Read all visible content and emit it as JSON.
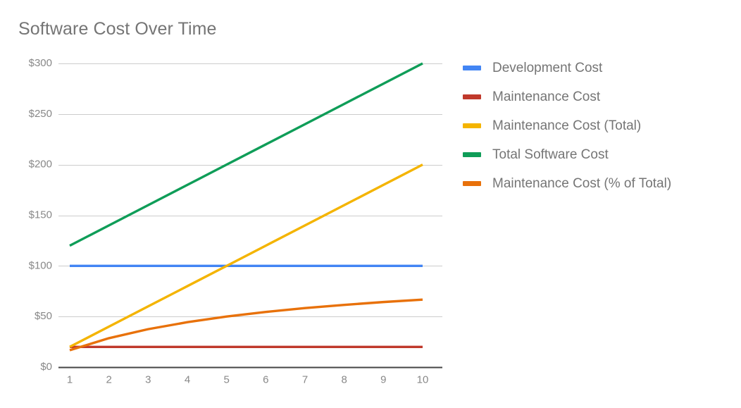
{
  "chart_data": {
    "type": "line",
    "title": "Software Cost Over Time",
    "xlabel": "",
    "ylabel": "",
    "x": [
      1,
      2,
      3,
      4,
      5,
      6,
      7,
      8,
      9,
      10
    ],
    "categories": [
      "1",
      "2",
      "3",
      "4",
      "5",
      "6",
      "7",
      "8",
      "9",
      "10"
    ],
    "xlim": [
      1,
      10
    ],
    "ylim": [
      0,
      300
    ],
    "y_ticks": [
      0,
      50,
      100,
      150,
      200,
      250,
      300
    ],
    "y_tick_labels": [
      "$0",
      "$50",
      "$100",
      "$150",
      "$200",
      "$250",
      "$300"
    ],
    "x_tick_labels": [
      "1",
      "2",
      "3",
      "4",
      "5",
      "6",
      "7",
      "8",
      "9",
      "10"
    ],
    "grid": true,
    "legend_position": "right",
    "series": [
      {
        "name": "Development Cost",
        "color": "#4285F4",
        "values": [
          100,
          100,
          100,
          100,
          100,
          100,
          100,
          100,
          100,
          100
        ]
      },
      {
        "name": "Maintenance Cost",
        "color": "#C0392B",
        "values": [
          20,
          20,
          20,
          20,
          20,
          20,
          20,
          20,
          20,
          20
        ]
      },
      {
        "name": "Maintenance Cost (Total)",
        "color": "#F4B400",
        "values": [
          20,
          40,
          60,
          80,
          100,
          120,
          140,
          160,
          180,
          200
        ]
      },
      {
        "name": "Total Software Cost",
        "color": "#0F9D58",
        "values": [
          120,
          140,
          160,
          180,
          200,
          220,
          240,
          260,
          280,
          300
        ]
      },
      {
        "name": "Maintenance Cost (% of Total)",
        "color": "#E8710A",
        "values": [
          16.7,
          28.6,
          37.5,
          44.4,
          50,
          54.5,
          58.3,
          61.5,
          64.3,
          66.7
        ]
      }
    ]
  },
  "legend": {
    "items": [
      {
        "label": "Development Cost",
        "color": "#4285F4"
      },
      {
        "label": "Maintenance Cost",
        "color": "#C0392B"
      },
      {
        "label": "Maintenance Cost (Total)",
        "color": "#F4B400"
      },
      {
        "label": "Total Software Cost",
        "color": "#0F9D58"
      },
      {
        "label": "Maintenance Cost (% of Total)",
        "color": "#E8710A"
      }
    ]
  }
}
